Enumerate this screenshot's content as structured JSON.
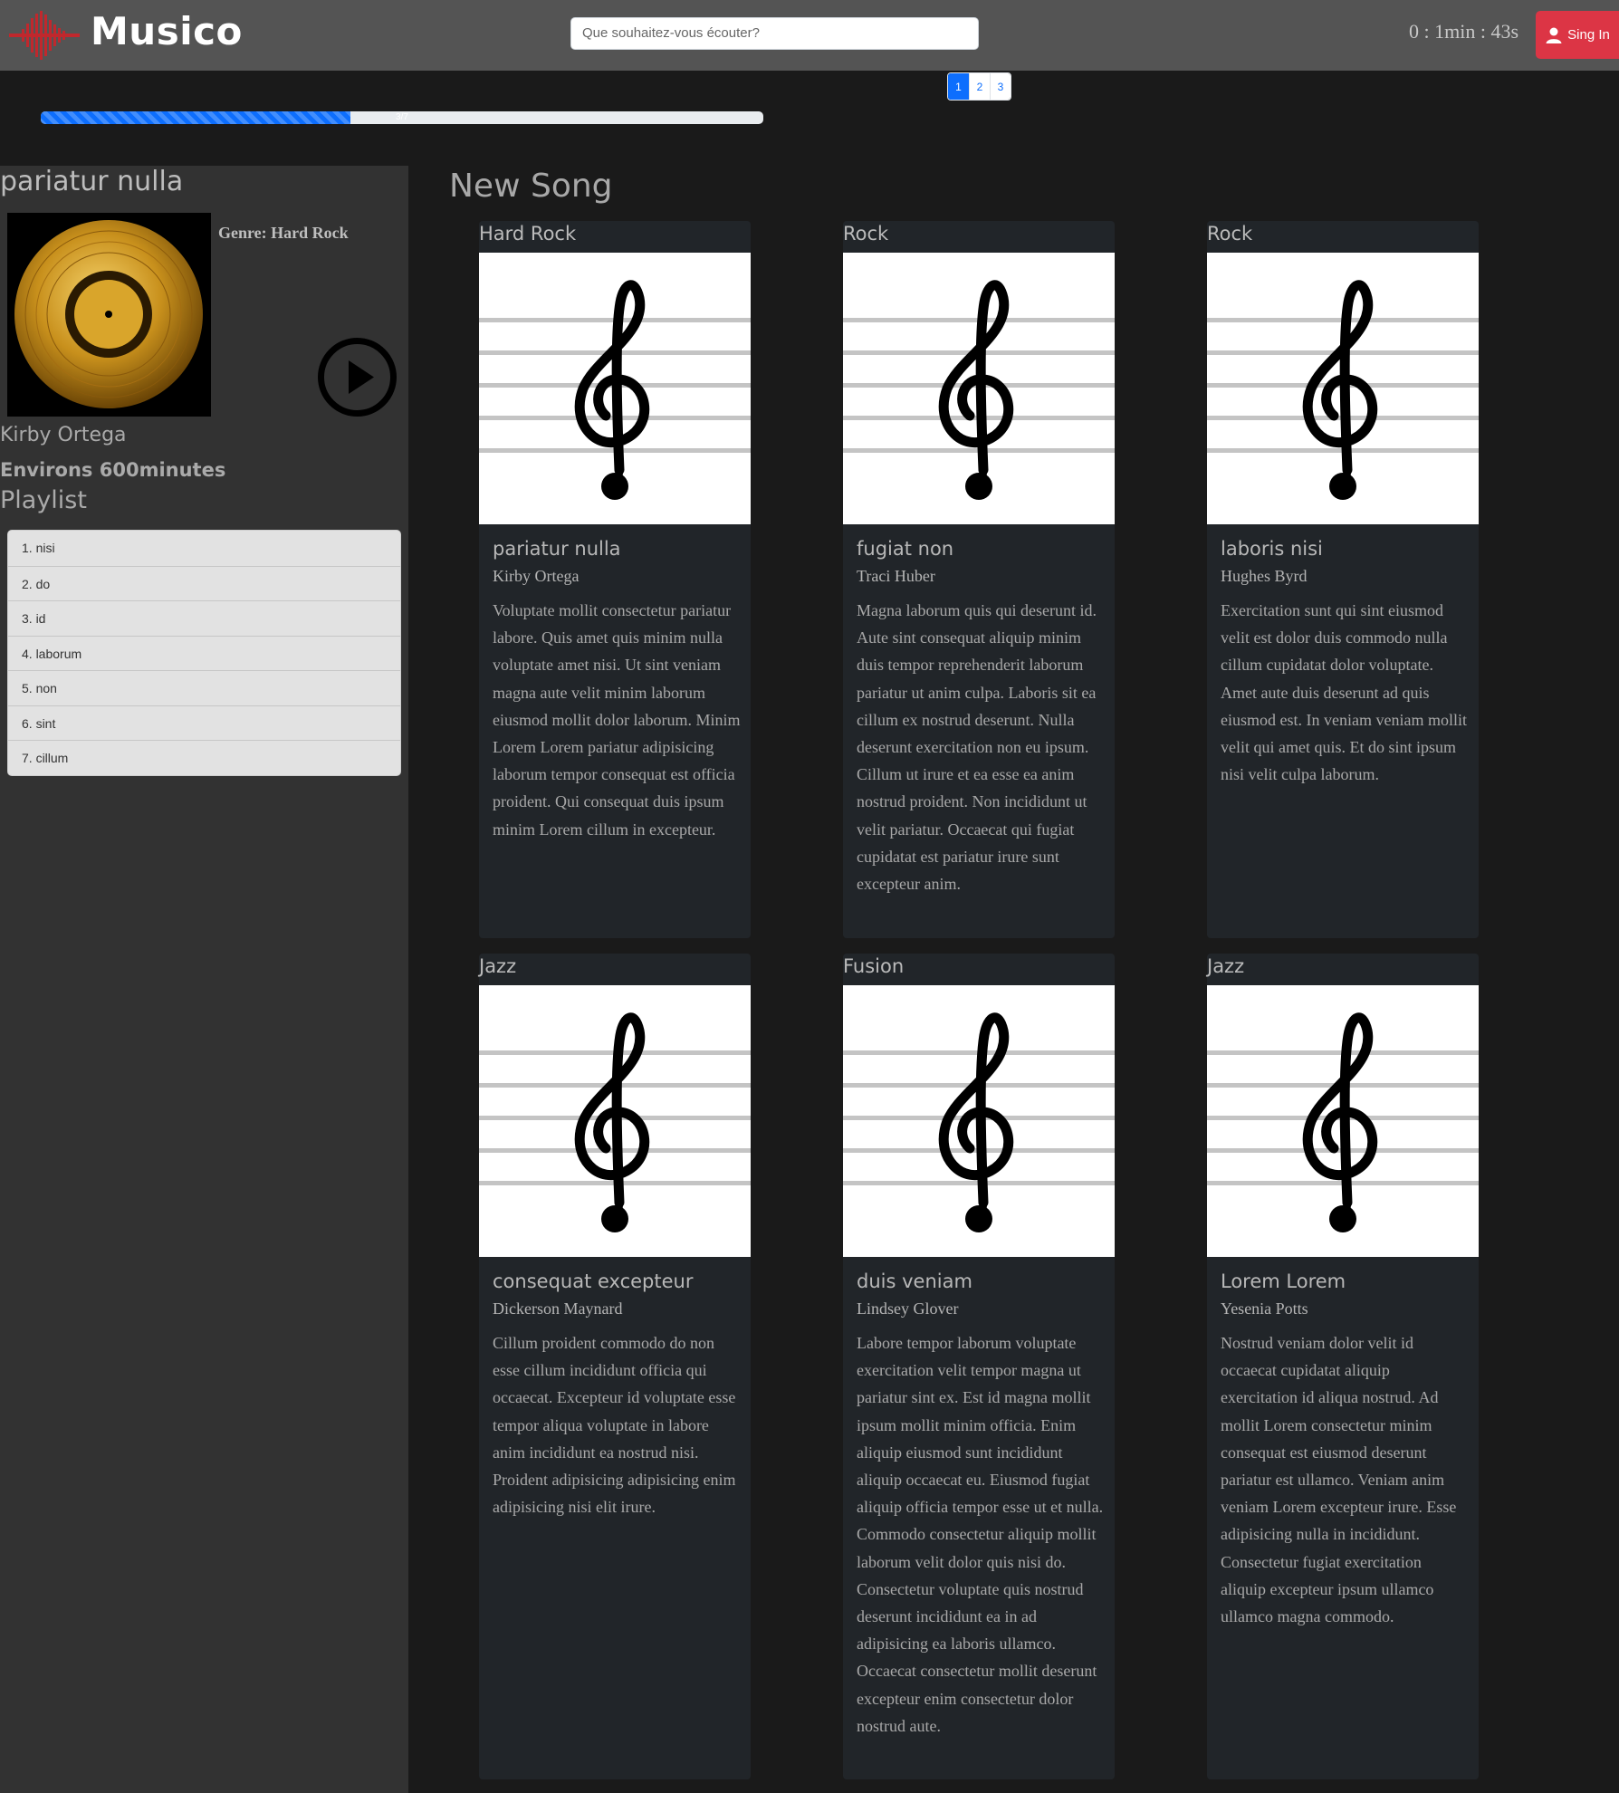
{
  "header": {
    "brand": "Musico",
    "search_placeholder": "Que souhaitez-vous écouter?",
    "timer": "0 : 1min : 43s",
    "signin_label": "Sing In"
  },
  "pagination": {
    "pages": [
      "1",
      "2",
      "3"
    ],
    "active_page": "1"
  },
  "progress": {
    "label": "3/7",
    "value_fraction": 0.4286
  },
  "sidebar": {
    "title": "pariatur nulla",
    "genre": "Genre: Hard Rock",
    "artist": "Kirby Ortega",
    "duration": "Environs 600minutes",
    "playlist_heading": "Playlist",
    "playlist": [
      "1. nisi",
      "2. do",
      "3. id",
      "4. laborum",
      "5. non",
      "6. sint",
      "7. cillum"
    ]
  },
  "main": {
    "title": "New Song",
    "cards": [
      {
        "genre": "Hard Rock",
        "title": "pariatur nulla",
        "artist": "Kirby Ortega",
        "text": "Voluptate mollit consectetur pariatur labore. Quis amet quis minim nulla voluptate amet nisi. Ut sint veniam magna aute velit minim laborum eiusmod mollit dolor laborum. Minim Lorem Lorem pariatur adipisicing laborum tempor consequat est officia proident. Qui consequat duis ipsum minim Lorem cillum in excepteur."
      },
      {
        "genre": "Rock",
        "title": "fugiat non",
        "artist": "Traci Huber",
        "text": "Magna laborum quis qui deserunt id. Aute sint consequat aliquip minim duis tempor reprehenderit laborum pariatur ut anim culpa. Laboris sit ea cillum ex nostrud deserunt. Nulla deserunt exercitation non eu ipsum. Cillum ut irure et ea esse ea anim nostrud proident. Non incididunt ut velit pariatur. Occaecat qui fugiat cupidatat est pariatur irure sunt excepteur anim."
      },
      {
        "genre": "Rock",
        "title": "laboris nisi",
        "artist": "Hughes Byrd",
        "text": "Exercitation sunt qui sint eiusmod velit est dolor duis commodo nulla cillum cupidatat dolor voluptate. Amet aute duis deserunt ad quis eiusmod est. In veniam veniam mollit velit qui amet quis. Et do sint ipsum nisi velit culpa laborum."
      },
      {
        "genre": "Jazz",
        "title": "consequat excepteur",
        "artist": "Dickerson Maynard",
        "text": "Cillum proident commodo do non esse cillum incididunt officia qui occaecat. Excepteur id voluptate esse tempor aliqua voluptate in labore anim incididunt ea nostrud nisi. Proident adipisicing adipisicing enim adipisicing nisi elit irure."
      },
      {
        "genre": "Fusion",
        "title": "duis veniam",
        "artist": "Lindsey Glover",
        "text": "Labore tempor laborum voluptate exercitation velit tempor magna ut pariatur sint ex. Est id magna mollit ipsum mollit minim officia. Enim aliquip eiusmod sunt incididunt aliquip occaecat eu. Eiusmod fugiat aliquip officia tempor esse ut et nulla. Commodo consectetur aliquip mollit laborum velit dolor quis nisi do. Consectetur voluptate quis nostrud deserunt incididunt ea in ad adipisicing ea laboris ullamco. Occaecat consectetur mollit deserunt excepteur enim consectetur dolor nostrud aute."
      },
      {
        "genre": "Jazz",
        "title": "Lorem Lorem",
        "artist": "Yesenia Potts",
        "text": "Nostrud veniam dolor velit id occaecat cupidatat aliquip exercitation id aliqua nostrud. Ad mollit Lorem consectetur minim consequat est eiusmod deserunt pariatur est ullamco. Veniam anim veniam Lorem excepteur irure. Esse adipisicing nulla in incididunt. Consectetur fugiat exercitation aliquip excepteur ipsum ullamco ullamco magna commodo."
      }
    ]
  },
  "icons": {
    "logo": "soundwave-logo-icon",
    "user": "user-icon",
    "play": "play-circle-icon",
    "card_image": "treble-clef-icon",
    "album": "golden-record-icon"
  },
  "colors": {
    "navbar": "#545454",
    "background": "#1a1a1a",
    "sidebar": "#323232",
    "card": "#212529",
    "accent": "#0d6efd",
    "signin": "#dc3545",
    "logo": "#c0282d"
  }
}
